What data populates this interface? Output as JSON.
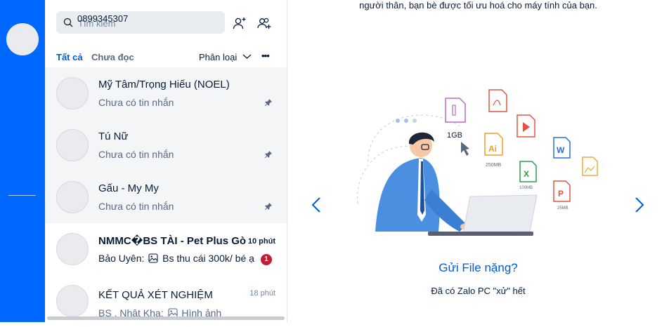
{
  "search": {
    "placeholder": "Tìm kiếm",
    "value": "0899345307"
  },
  "filters": {
    "all": "Tất cả",
    "unread": "Chưa đọc",
    "classify": "Phân loại",
    "more": "•••"
  },
  "conversations": [
    {
      "name": "Mỹ Tâm/Trọng Hiếu (NOEL)",
      "preview": "Chưa có tin nhắn",
      "pinned": true
    },
    {
      "name": "Tú Nữ",
      "preview": "Chưa có tin nhắn",
      "pinned": true
    },
    {
      "name": "Gấu - My My",
      "preview": "Chưa có tin nhắn",
      "pinned": true
    },
    {
      "name": "NMMC�BS TÀI - Pet Plus Gò",
      "time": "10 phút",
      "preview_sender": "Bảo Uyên:",
      "preview": "Bs thu cái 300k/ bé ạ",
      "unread": "1"
    },
    {
      "name": "KẾT QUẢ XÉT NGHIỆM",
      "time": "18 phút",
      "preview_sender": "BS . Nhật Kha:",
      "preview": "Hình ảnh"
    }
  ],
  "main": {
    "top_text": "người thân, bạn bè được tối ưu hoá cho máy tính của bạn.",
    "slide_title": "Gửi File nặng?",
    "slide_subtitle": "Đã có Zalo PC \"xử\" hết",
    "illustration_labels": {
      "size_1gb": "1GB",
      "size_250": "250MB",
      "size_100": "100MB",
      "size_25": "25MB",
      "ai": "Ai",
      "word": "W",
      "excel": "X",
      "ppt": "P"
    }
  },
  "colors": {
    "rail": "#0068ff",
    "accent": "#005ae0",
    "badge": "#c31d36"
  }
}
